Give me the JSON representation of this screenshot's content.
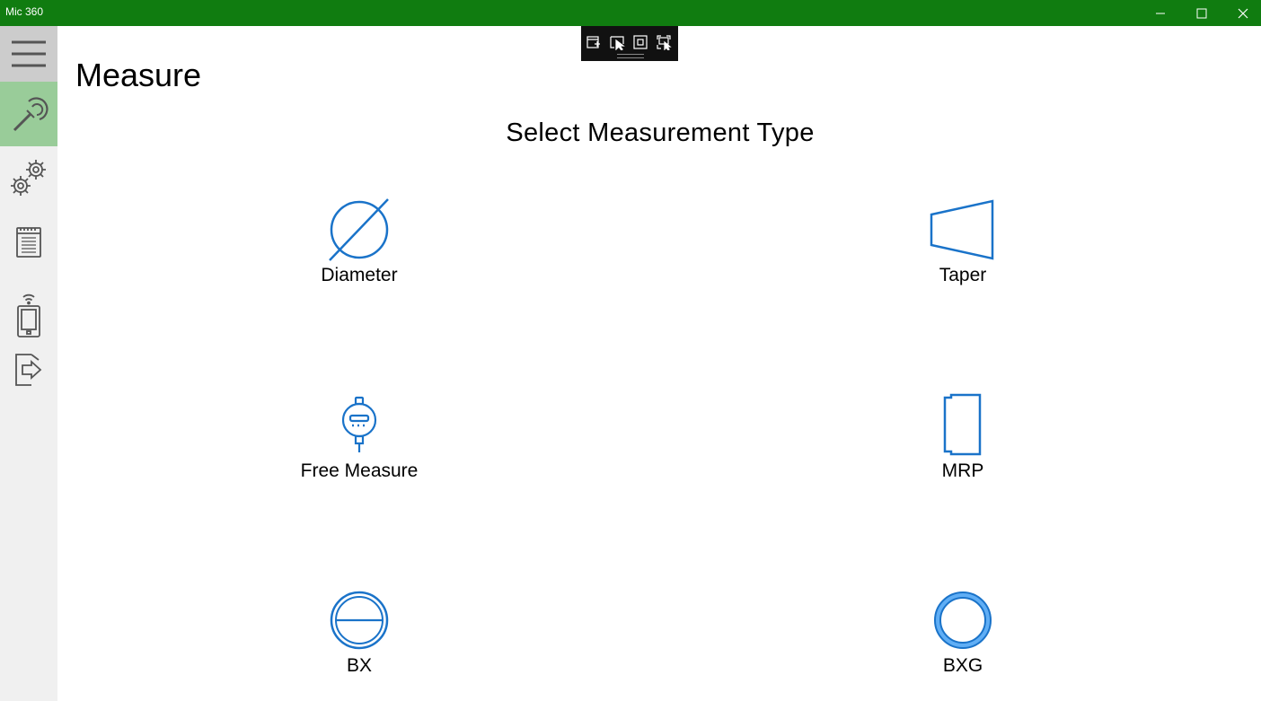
{
  "window": {
    "title": "Mic 360",
    "minimize_icon": "minimize-icon",
    "maximize_icon": "maximize-icon",
    "close_icon": "close-icon"
  },
  "colors": {
    "titlebar": "#107c10",
    "sidebar": "#f0f0f0",
    "sidebar_active": "#99cc99",
    "icon_blue": "#1a73c9"
  },
  "sidebar": {
    "items": [
      {
        "name": "menu",
        "icon": "hamburger-icon"
      },
      {
        "name": "measure",
        "icon": "micrometer-icon",
        "active": true
      },
      {
        "name": "settings",
        "icon": "gears-icon"
      },
      {
        "name": "reports",
        "icon": "document-icon"
      },
      {
        "name": "device",
        "icon": "wireless-device-icon"
      },
      {
        "name": "logout",
        "icon": "exit-icon"
      }
    ]
  },
  "toolbar": {
    "icons": [
      "insert-icon",
      "select-icon",
      "frame-icon",
      "capture-icon"
    ]
  },
  "page": {
    "title": "Measure",
    "heading": "Select Measurement Type"
  },
  "tiles": [
    {
      "label": "Diameter",
      "icon": "diameter-icon"
    },
    {
      "label": "Taper",
      "icon": "taper-icon"
    },
    {
      "label": "Free Measure",
      "icon": "dial-indicator-icon"
    },
    {
      "label": "MRP",
      "icon": "mrp-icon"
    },
    {
      "label": "BX",
      "icon": "bx-icon"
    },
    {
      "label": "BXG",
      "icon": "bxg-icon"
    }
  ]
}
